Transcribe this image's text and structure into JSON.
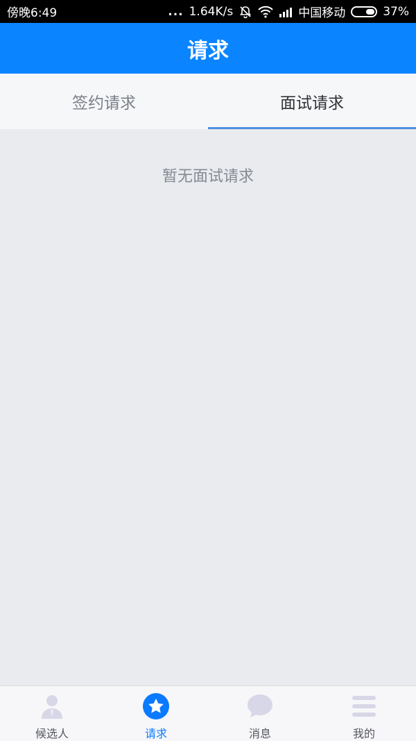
{
  "status_bar": {
    "time": "傍晚6:49",
    "dots": "...",
    "speed": "1.64K/s",
    "carrier": "中国移动",
    "battery": "37%",
    "icons": [
      "mute-bell-icon",
      "wifi-icon",
      "signal-icon",
      "battery-icon"
    ]
  },
  "header": {
    "title": "请求"
  },
  "tabs": [
    {
      "label": "签约请求",
      "active": false
    },
    {
      "label": "面试请求",
      "active": true
    }
  ],
  "empty_state": {
    "message": "暂无面试请求"
  },
  "bottom_nav": [
    {
      "label": "候选人",
      "icon": "person-icon",
      "active": false
    },
    {
      "label": "请求",
      "icon": "star-icon",
      "active": true
    },
    {
      "label": "消息",
      "icon": "chat-bubble-icon",
      "active": false
    },
    {
      "label": "我的",
      "icon": "menu-lines-icon",
      "active": false
    }
  ],
  "colors": {
    "brand": "#0a84ff",
    "tab_indicator": "#4a90e2",
    "nav_active": "#0a7aff",
    "nav_inactive_icon": "#d7d7e8"
  }
}
